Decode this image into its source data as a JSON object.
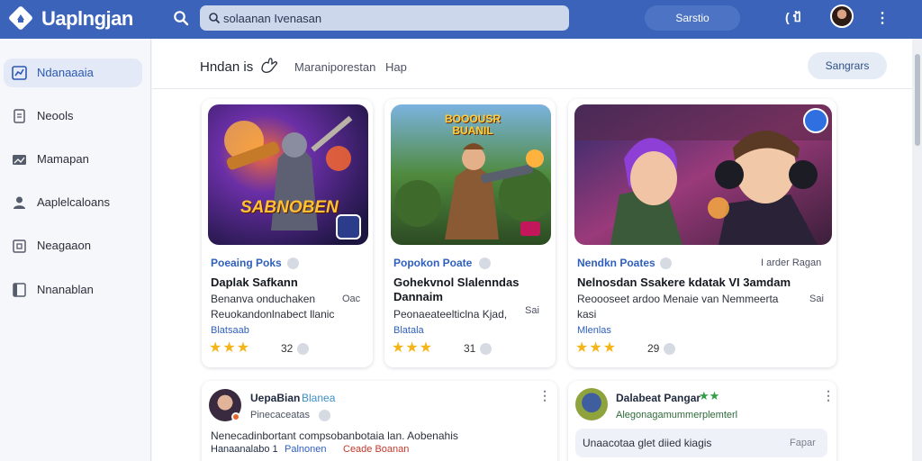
{
  "app": {
    "title": "Uaplngjan"
  },
  "search": {
    "value": "solaanan Ivenasan"
  },
  "topbar": {
    "pill_label": "Sarstio",
    "status_text": "( ป้",
    "kebab": "⋮"
  },
  "sidebar": {
    "items": [
      {
        "label": "Ndanaaaia",
        "icon": "chart-icon",
        "active": true
      },
      {
        "label": "Neools",
        "icon": "document-icon",
        "active": false
      },
      {
        "label": "Mamapan",
        "icon": "image-icon",
        "active": false
      },
      {
        "label": "Aaplelcaloans",
        "icon": "user-icon",
        "active": false
      },
      {
        "label": "Neagaaon",
        "icon": "calendar-icon",
        "active": false
      },
      {
        "label": "Nnanablan",
        "icon": "book-icon",
        "active": false
      }
    ]
  },
  "header": {
    "title": "Hndan is",
    "tabs": [
      "Maraniporestan",
      "Hap"
    ],
    "button_label": "Sangrars"
  },
  "cards": [
    {
      "category": "Poeaing Poks",
      "title": "Daplak Safkann",
      "desc1": "Benanva onduchaken",
      "desc2": "Reuokandonlnabect llanic",
      "side": "Oac",
      "tag": "Blatsaab",
      "rating": "32",
      "art_text": "SABNOBEN",
      "stars_filled": 3
    },
    {
      "category": "Popokon Poate",
      "title": "Gohekvnol Slalenndas",
      "title2": "Dannaim",
      "desc1": "Peonaeateelticlna Kjad,",
      "side": "Sai",
      "tag": "Blatala",
      "rating": "31",
      "art_text": "BOOOUSR BUANIL",
      "stars_filled": 3
    },
    {
      "category": "Nendkn Poates",
      "category_side": "I arder Ragan",
      "title": "Nelnosdan Ssakere kdatak VI 3amdam",
      "desc1": "Reoooseet ardoo Menaie van Nemmeerta",
      "desc2": "kasi",
      "side": "Sai",
      "tag": "Mlenlas",
      "rating": "29",
      "stars_filled": 3
    }
  ],
  "feed": [
    {
      "name": "UepaBian",
      "tag": "Blanea",
      "sub": "Pinecaceatas",
      "text": "Nenecadinbortant compsobanbotaia lan. Aobenahis",
      "meta_user": "Hanaanalabo 1",
      "meta_link": "Palnonen",
      "meta_red": "Ceade Boanan"
    },
    {
      "name": "Dalabeat Pangar",
      "sub": "Alegonagamummerplemterl",
      "reply_text": "Unaacotaa glet diied kiagis",
      "reply_action": "Fapar"
    }
  ],
  "colors": {
    "accent": "#3a63b9",
    "star": "#f3b51a",
    "link": "#2f5fbd",
    "red": "#c0392b",
    "green": "#2f9e44"
  }
}
